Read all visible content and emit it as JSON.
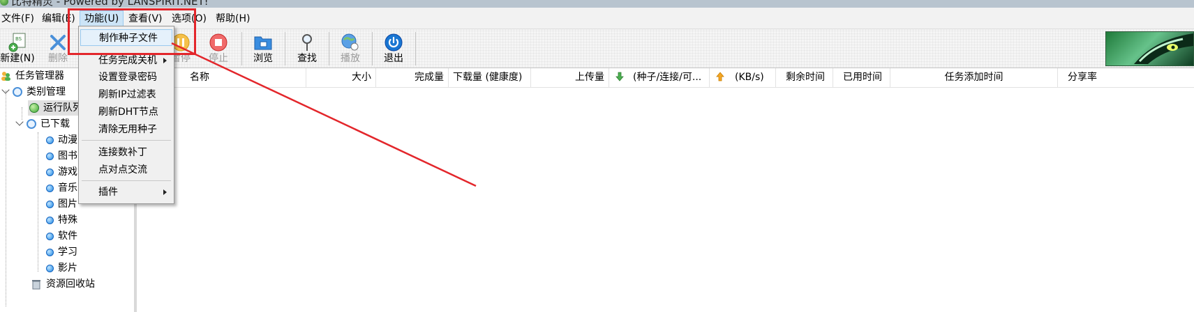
{
  "window": {
    "title": "比特精灵 - Powered by LANSPIRIT.NET!"
  },
  "menubar": {
    "items": [
      {
        "label": "文件(F)"
      },
      {
        "label": "编辑(E)"
      },
      {
        "label": "功能(U)"
      },
      {
        "label": "查看(V)"
      },
      {
        "label": "选项(O)"
      },
      {
        "label": "帮助(H)"
      }
    ],
    "active_index": 2
  },
  "toolbar": {
    "buttons": [
      {
        "label": "新建(N)",
        "icon": "new-torrent-icon",
        "enabled": true
      },
      {
        "label": "删除",
        "icon": "delete-x-icon",
        "enabled": false
      },
      {
        "label": "暂停",
        "icon": "pause-icon",
        "enabled": false
      },
      {
        "label": "停止",
        "icon": "stop-icon",
        "enabled": false
      },
      {
        "label": "浏览",
        "icon": "folder-browse-icon",
        "enabled": true
      },
      {
        "label": "查找",
        "icon": "search-icon",
        "enabled": true
      },
      {
        "label": "播放",
        "icon": "globe-play-icon",
        "enabled": false
      },
      {
        "label": "退出",
        "icon": "power-icon",
        "enabled": true
      }
    ]
  },
  "dropdown": {
    "items": [
      {
        "label": "制作种子文件",
        "highlighted": true
      },
      {
        "label": "任务完成关机",
        "submenu": true
      },
      {
        "label": "设置登录密码"
      },
      {
        "label": "刷新IP过滤表"
      },
      {
        "label": "刷新DHT节点"
      },
      {
        "label": "清除无用种子"
      },
      {
        "label": "连接数补丁"
      },
      {
        "label": "点对点交流"
      },
      {
        "label": "插件",
        "submenu": true
      }
    ]
  },
  "tree": {
    "root": "任务管理器",
    "category_manager": "类别管理",
    "running_queue": "运行队列",
    "downloaded": "已下载",
    "categories": [
      "动漫",
      "图书",
      "游戏",
      "音乐",
      "图片",
      "特殊",
      "软件",
      "学习",
      "影片"
    ],
    "recycle_bin": "资源回收站"
  },
  "columns": [
    {
      "label": "名称"
    },
    {
      "label": "大小"
    },
    {
      "label": "完成量"
    },
    {
      "label": "下载量 (健康度)"
    },
    {
      "label": "上传量"
    },
    {
      "label": "(种子/连接/可..."
    },
    {
      "label": "(KB/s)"
    },
    {
      "label": "剩余时间"
    },
    {
      "label": "已用时间"
    },
    {
      "label": "任务添加时间"
    },
    {
      "label": "分享率"
    }
  ],
  "colors": {
    "annotation_red": "#e3262b",
    "menu_highlight": "#cce4f7",
    "selection_blue": "#99c9ef"
  }
}
